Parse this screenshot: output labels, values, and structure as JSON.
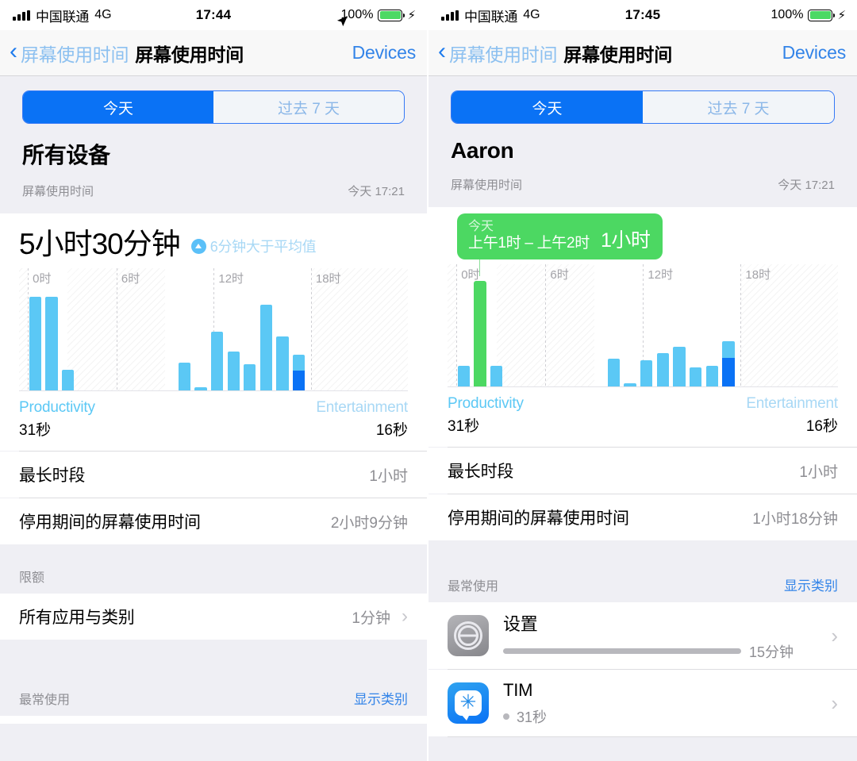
{
  "panels": [
    {
      "status_bar": {
        "carrier": "中国联通",
        "network": "4G",
        "time": "17:44",
        "battery_pct": "100%",
        "location_icon": "location-arrow-icon",
        "charging_icon": "bolt-icon",
        "signal_icon": "signal-bars-icon"
      },
      "nav": {
        "back_label": "屏幕使用时间",
        "title": "屏幕使用时间",
        "right_label": "Devices",
        "back_icon": "chevron-left-icon"
      },
      "segmented": {
        "options": [
          "今天",
          "过去 7 天"
        ],
        "selected": "今天"
      },
      "header": {
        "name": "所有设备",
        "meta_label": "屏幕使用时间",
        "meta_value": "今天 17:21"
      },
      "summary": {
        "total": "5小时30分钟",
        "average_note": "6分钟大于平均值",
        "average_icon": "arrow-up-circle-icon"
      },
      "legend": {
        "left_category": "Productivity",
        "left_value": "31秒",
        "right_category": "Entertainment",
        "right_value": "16秒"
      },
      "rows": [
        {
          "label": "最长时段",
          "value": "1小时"
        },
        {
          "label": "停用期间的屏幕使用时间",
          "value": "2小时9分钟"
        }
      ],
      "limits_section": {
        "title": "限额",
        "row": {
          "label": "所有应用与类别",
          "value": "1分钟",
          "chevron": "chevron-right-icon"
        }
      },
      "most_used_section": {
        "title": "最常使用",
        "action": "显示类别"
      },
      "apps": []
    },
    {
      "status_bar": {
        "carrier": "中国联通",
        "network": "4G",
        "time": "17:45",
        "battery_pct": "100%",
        "location_icon": "",
        "charging_icon": "bolt-icon",
        "signal_icon": "signal-bars-icon"
      },
      "nav": {
        "back_label": "屏幕使用时间",
        "title": "屏幕使用时间",
        "right_label": "Devices",
        "back_icon": "chevron-left-icon"
      },
      "segmented": {
        "options": [
          "今天",
          "过去 7 天"
        ],
        "selected": "今天"
      },
      "header": {
        "name": "Aaron",
        "meta_label": "屏幕使用时间",
        "meta_value": "今天 17:21"
      },
      "summary": {
        "total": "",
        "average_note": "",
        "average_icon": ""
      },
      "tooltip": {
        "day": "今天",
        "range": "上午1时 – 上午2时",
        "duration": "1小时"
      },
      "legend": {
        "left_category": "Productivity",
        "left_value": "31秒",
        "right_category": "Entertainment",
        "right_value": "16秒"
      },
      "rows": [
        {
          "label": "最长时段",
          "value": "1小时"
        },
        {
          "label": "停用期间的屏幕使用时间",
          "value": "1小时18分钟"
        }
      ],
      "most_used_section": {
        "title": "最常使用",
        "action": "显示类别"
      },
      "apps": [
        {
          "name": "设置",
          "time": "15分钟",
          "icon": "settings-gear-icon",
          "meter_pct": 78,
          "chevron": "chevron-right-icon"
        },
        {
          "name": "TIM",
          "time": "31秒",
          "icon": "tim-app-icon",
          "meter_pct": 0,
          "chevron": "chevron-right-icon"
        }
      ]
    }
  ],
  "chart_data": [
    {
      "type": "bar",
      "title": "所有设备 今天 屏幕使用时间",
      "xlabel": "",
      "ylabel": "",
      "tick_labels": [
        "0时",
        "6时",
        "12时",
        "18时"
      ],
      "tick_hours": [
        0,
        6,
        12,
        18
      ],
      "xlim": [
        0,
        24
      ],
      "ylim": [
        0,
        60
      ],
      "grid": true,
      "legend": [
        "Productivity",
        "Entertainment"
      ],
      "colors": {
        "productivity": "#5bc8f5",
        "entertainment": "#0a72f5",
        "selected": "#4cd862"
      },
      "x": [
        0,
        1,
        2,
        9,
        10,
        11,
        12,
        13,
        14,
        15,
        16
      ],
      "series": [
        {
          "name": "Productivity",
          "values": [
            58,
            58,
            13,
            17,
            1.5,
            36,
            24,
            16,
            52,
            33,
            11
          ]
        },
        {
          "name": "Entertainment",
          "values": [
            0,
            0,
            0,
            0,
            0,
            0,
            0,
            0,
            0,
            0,
            12
          ]
        }
      ]
    },
    {
      "type": "bar",
      "title": "Aaron 今天 屏幕使用时间",
      "xlabel": "",
      "ylabel": "",
      "tick_labels": [
        "0时",
        "6时",
        "12时",
        "18时"
      ],
      "tick_hours": [
        0,
        6,
        12,
        18
      ],
      "xlim": [
        0,
        24
      ],
      "ylim": [
        0,
        60
      ],
      "grid": true,
      "legend": [
        "Productivity",
        "Entertainment"
      ],
      "colors": {
        "productivity": "#5bc8f5",
        "entertainment": "#0a72f5",
        "selected": "#4cd862"
      },
      "highlighted_bar": {
        "hour": 1,
        "value": 60,
        "label": "1小时"
      },
      "x": [
        0,
        1,
        2,
        9,
        10,
        11,
        12,
        13,
        14,
        15,
        16
      ],
      "series": [
        {
          "name": "Productivity",
          "values": [
            13,
            60,
            13,
            17,
            1.5,
            17,
            21,
            25,
            12,
            13,
            11
          ]
        },
        {
          "name": "Entertainment",
          "values": [
            0,
            0,
            0,
            0,
            0,
            0,
            0,
            0,
            0,
            0,
            18
          ]
        }
      ]
    }
  ]
}
